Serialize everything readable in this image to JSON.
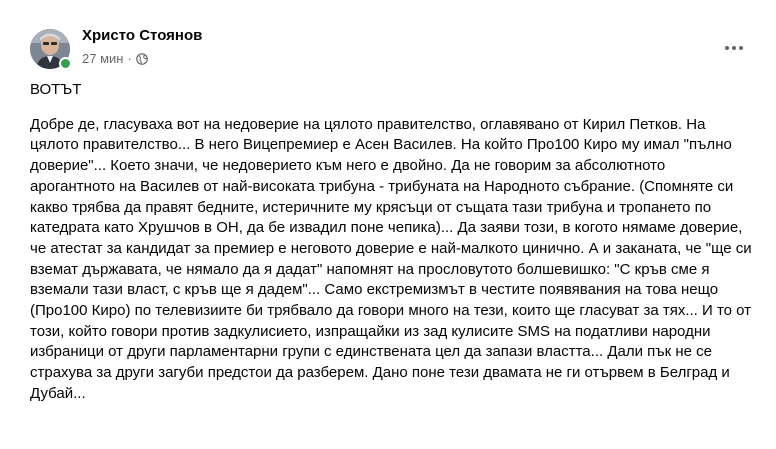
{
  "post": {
    "author": "Христо Стоянов",
    "time": "27 мин",
    "separator": "·",
    "privacy_icon": "globe-icon",
    "more_icon": "more-options-icon",
    "headline": "ВОТЪТ",
    "body": "Добре де, гласуваха вот на недоверие на цялото правителство, оглавявано от Кирил Петков. На цялото правителство... В него Вицепремиер е Асен Василев. На който Про100 Киро му имал \"пълно доверие\"... Което значи, че недоверието към него е двойно. Да не говорим за абсолютното арогантното на Василев от най-високата трибуна  - трибуната на Народното събрание. (Спомняте си какво трябва да правят бедните, истеричните му крясъци от същата тази трибуна и тропането по катедрата като Хрушчов в ОН, да бе извадил поне чепика)... Да заяви този, в когото нямаме доверие, че атестат за кандидат  за премиер е неговото доверие е най-малкото цинично.  А и заканата, че \"ще си вземат държавата, че нямало да я дадат\" напомнят на прословутото болшевишко: \"С кръв сме я вземали тази власт, с кръв ще я дадем\"... Само екстремизмът в честите появявания на това нещо (Про100 Киро) по телевизиите би трябвало да говори много на тези, които ще гласуват за тях... И то от този, който говори против задкулисието, изпращайки из зад кулисите SMS на податливи народни избраници от други парламентарни групи с единствената цел да запази властта... Дали пък не се страхува за други загуби предстои да разберем. Дано поне тези двамата не ги отървем в Белград и Дубай..."
  },
  "colors": {
    "text": "#050505",
    "secondary": "#65676b",
    "online": "#31a24c"
  }
}
